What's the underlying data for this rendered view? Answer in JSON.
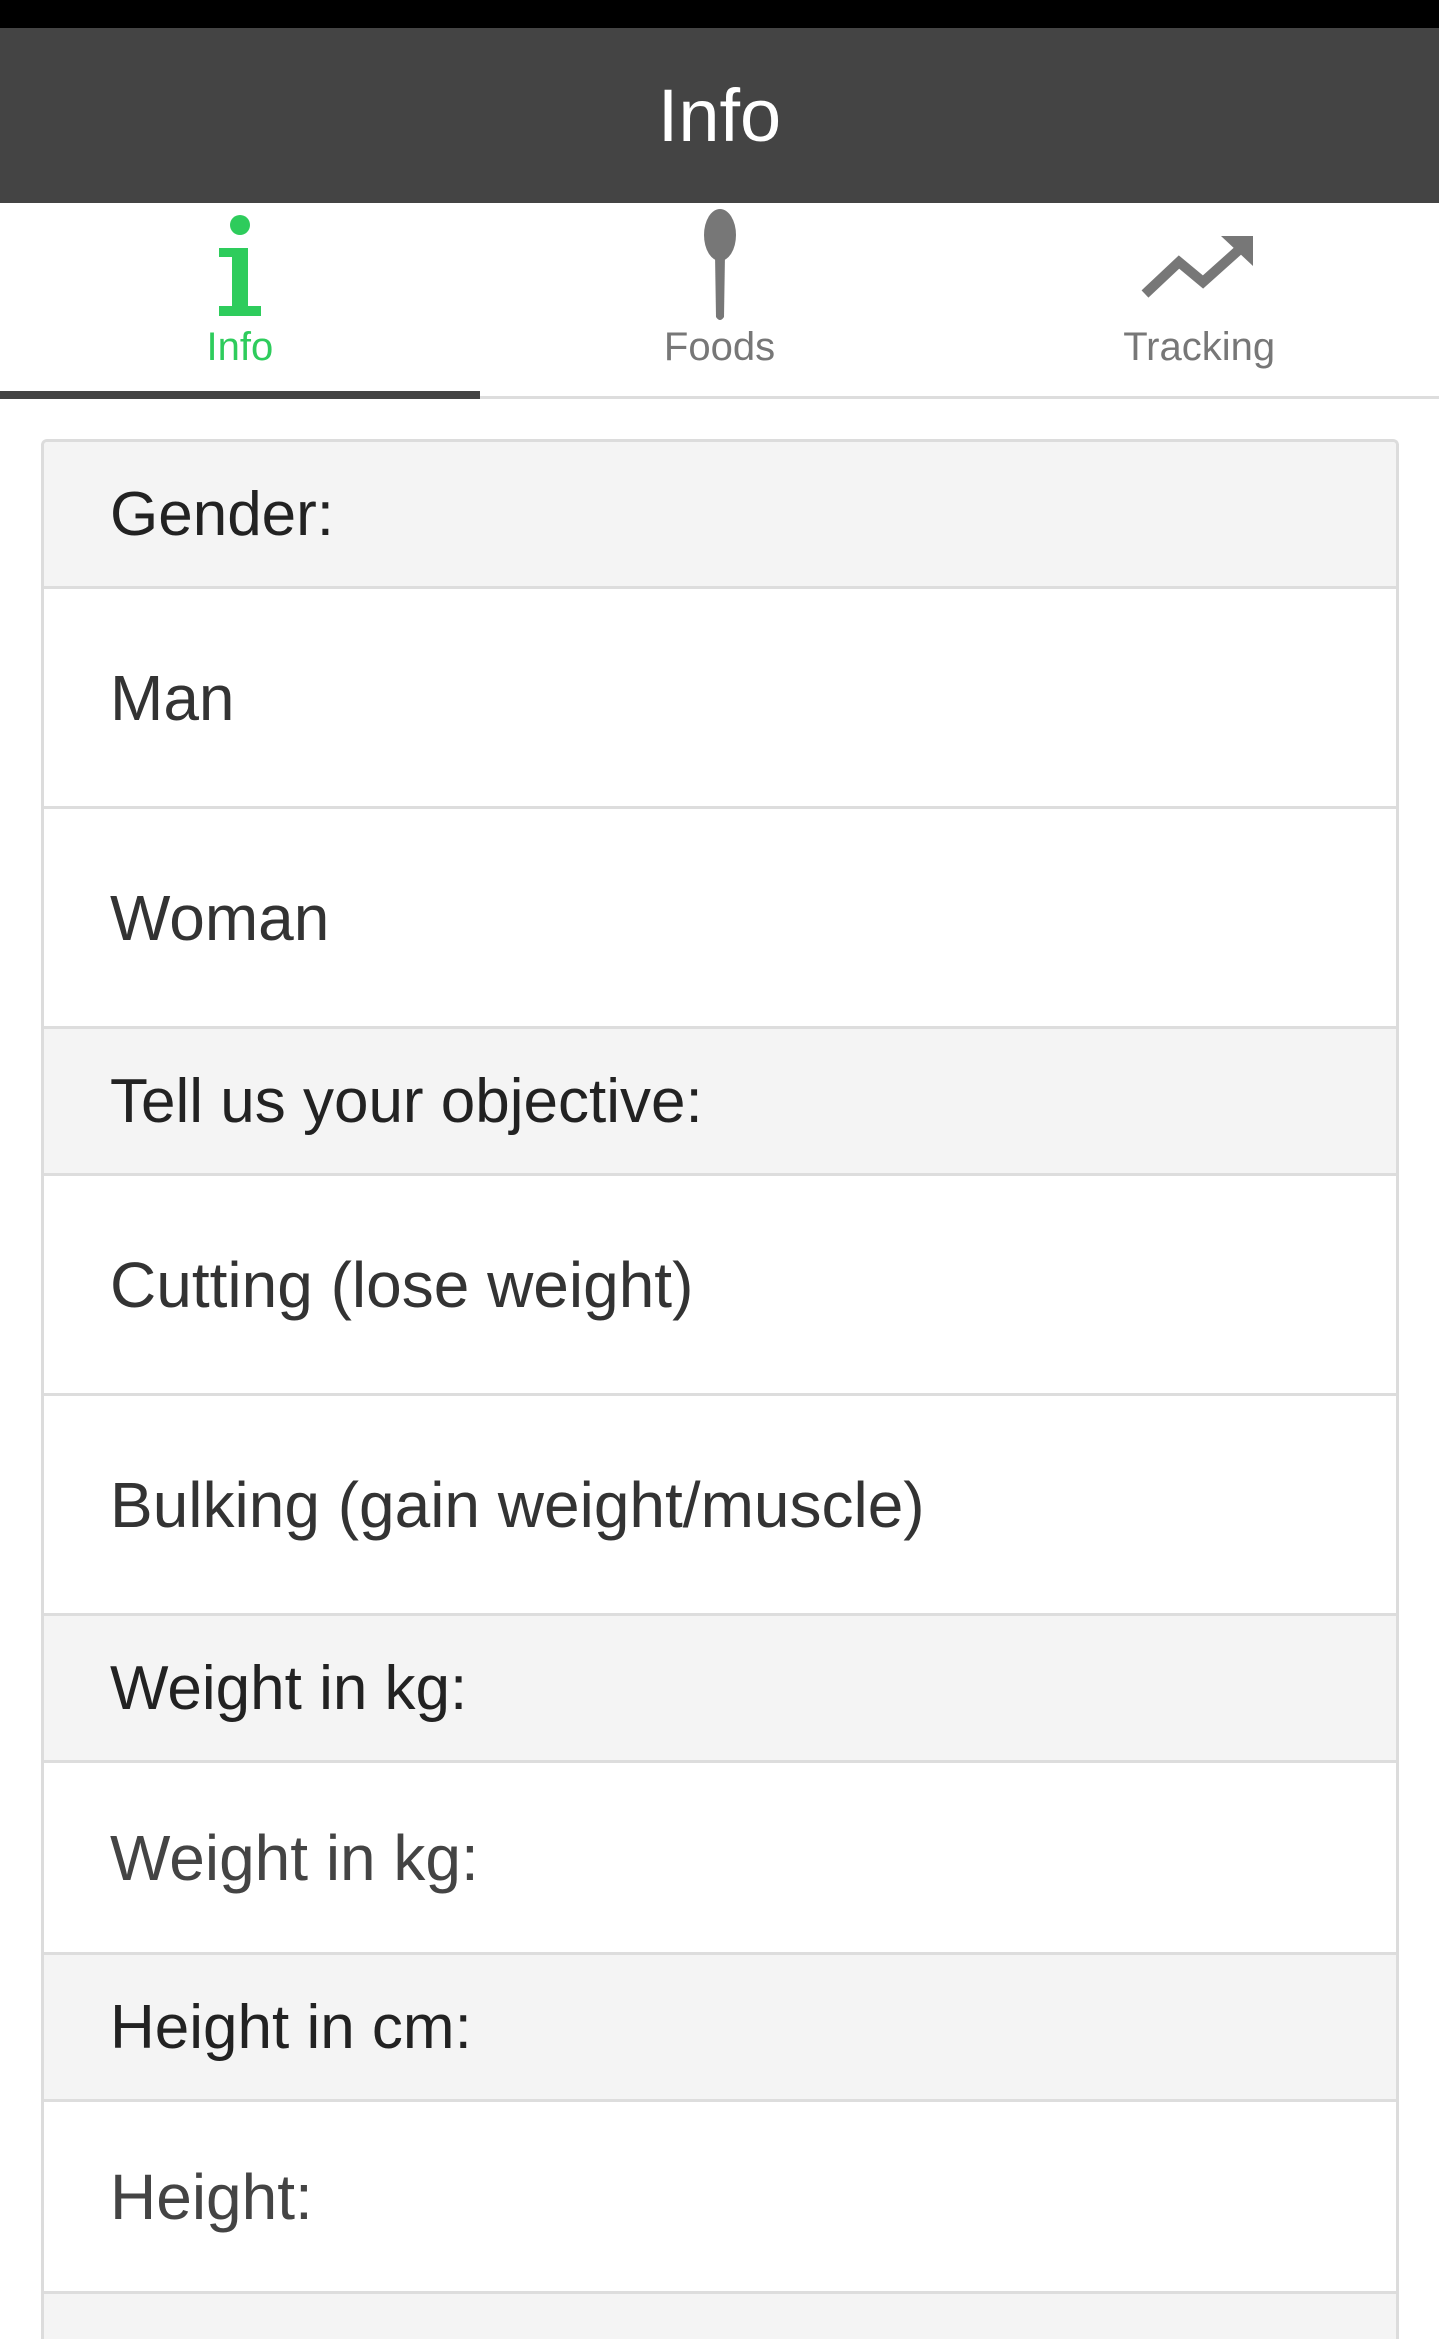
{
  "header": {
    "title": "Info"
  },
  "tabs": [
    {
      "label": "Info",
      "icon": "info-icon",
      "active": true
    },
    {
      "label": "Foods",
      "icon": "spoon-icon",
      "active": false
    },
    {
      "label": "Tracking",
      "icon": "trending-up-icon",
      "active": false
    }
  ],
  "colors": {
    "header_bg": "#444444",
    "active_tab": "#2ecc5c",
    "inactive_tab": "#777777",
    "section_bg": "#f4f4f4"
  },
  "form": {
    "gender_heading": "Gender:",
    "gender_options": [
      "Man",
      "Woman"
    ],
    "objective_heading": "Tell us your objective:",
    "objective_options": [
      "Cutting (lose weight)",
      "Bulking (gain weight/muscle)"
    ],
    "weight_heading": "Weight in kg:",
    "weight_placeholder": "Weight in kg:",
    "weight_value": "",
    "height_heading": "Height in cm:",
    "height_placeholder": "Height:",
    "height_value": ""
  }
}
